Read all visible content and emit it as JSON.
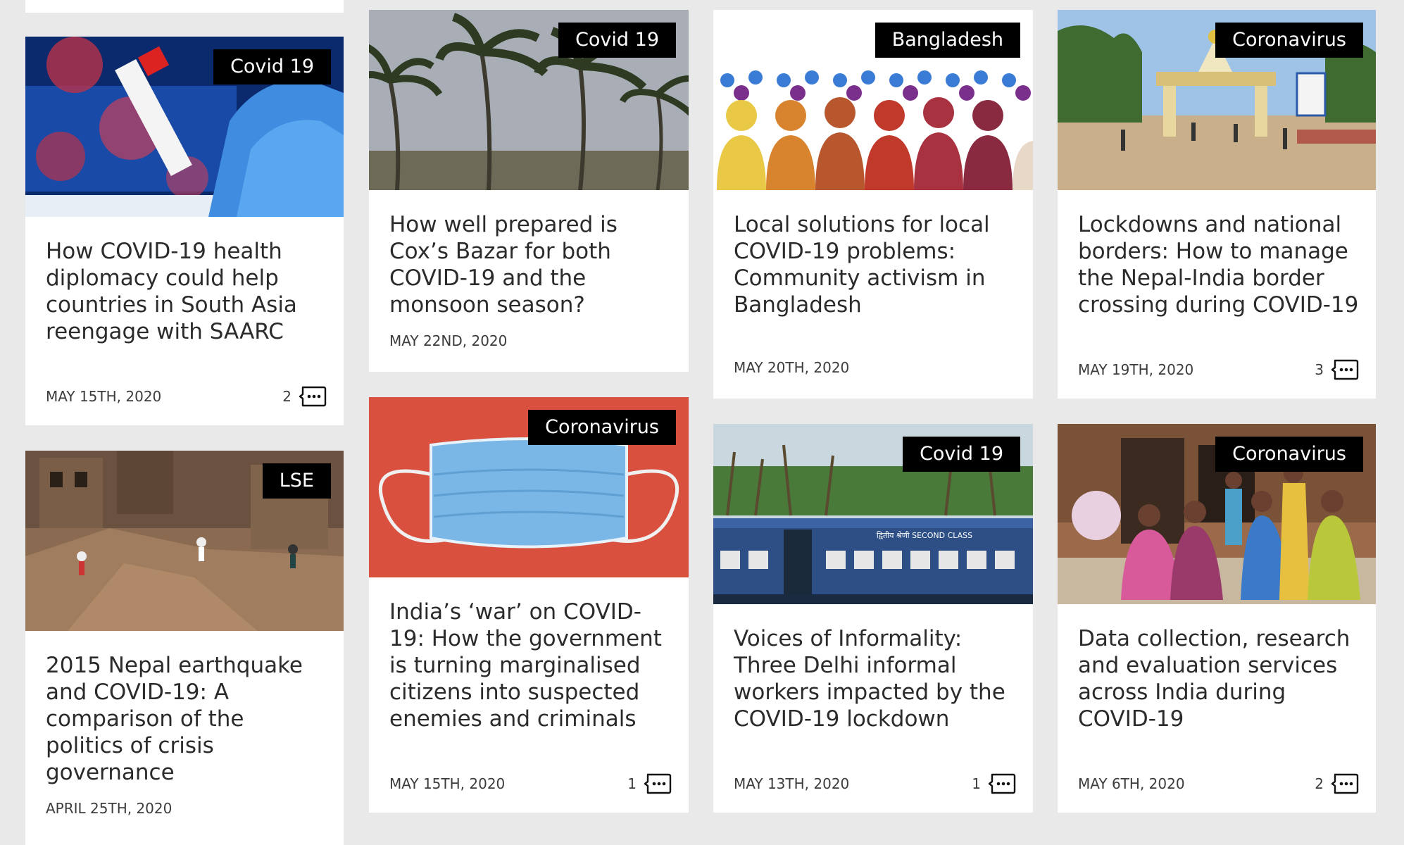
{
  "colors": {
    "page_bg": "#e9e9e9",
    "card_bg": "#ffffff",
    "tag_bg": "#000000",
    "tag_text": "#ffffff",
    "title_text": "#2b2b2b"
  },
  "cards": [
    {
      "tag": "Covid 19",
      "title": "How COVID-19 health diplomacy could help countries in South Asia reengage with SAARC",
      "date": "MAY 15TH, 2020",
      "comments": "2",
      "image_icon": "covid-test-tube-image"
    },
    {
      "tag": "LSE",
      "title": "2015 Nepal earthquake and COVID-19: A comparison of the politics of crisis governance",
      "date": "APRIL 25TH, 2020",
      "comments": "",
      "image_icon": "earthquake-rubble-image"
    },
    {
      "tag": "Covid 19",
      "title": "How well prepared is Cox’s Bazar for both COVID-19 and the monsoon season?",
      "date": "MAY 22ND, 2020",
      "comments": "",
      "image_icon": "palm-trees-storm-image"
    },
    {
      "tag": "Coronavirus",
      "title": "India’s ‘war’ on COVID-19: How the government is turning marginalised citizens into suspected enemies and criminals",
      "date": "MAY 15TH, 2020",
      "comments": "1",
      "image_icon": "face-mask-image"
    },
    {
      "tag": "Bangladesh",
      "title": "Local solutions for local COVID-19 problems: Community activism in Bangladesh",
      "date": "MAY 20TH, 2020",
      "comments": "",
      "image_icon": "crowd-illustration-image"
    },
    {
      "tag": "Covid 19",
      "title": "Voices of Informality: Three Delhi informal workers impacted by the COVID-19 lockdown",
      "date": "MAY 13TH, 2020",
      "comments": "1",
      "image_icon": "train-image",
      "image_text": "द्वितीय श्रेणी SECOND CLASS"
    },
    {
      "tag": "Coronavirus",
      "title": "Lockdowns and national borders: How to manage the Nepal-India border crossing during COVID-19",
      "date": "MAY 19TH, 2020",
      "comments": "3",
      "image_icon": "border-gate-image"
    },
    {
      "tag": "Coronavirus",
      "title": "Data collection, research and evaluation services across India during COVID-19",
      "date": "MAY 6TH, 2020",
      "comments": "2",
      "image_icon": "women-survey-image"
    }
  ]
}
